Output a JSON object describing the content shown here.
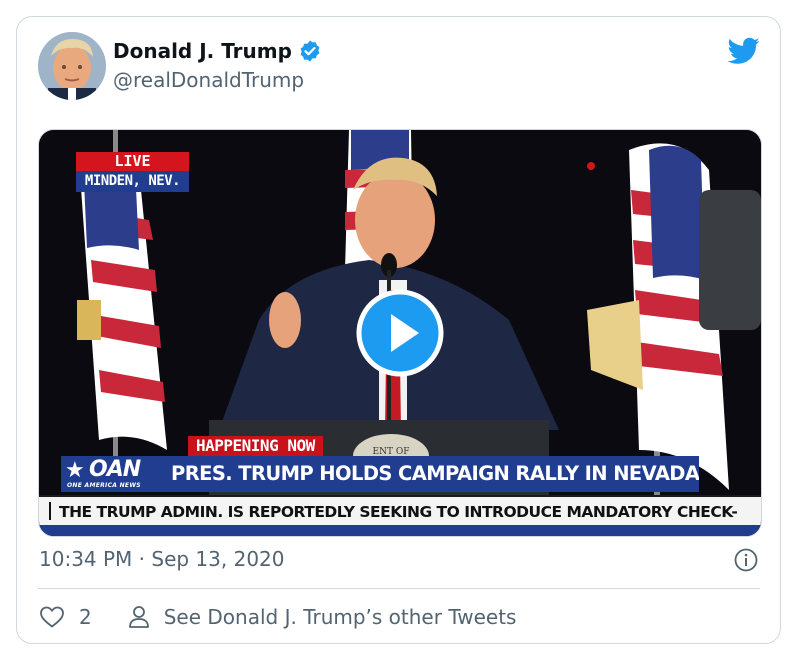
{
  "tweet": {
    "author_name": "Donald J. Trump",
    "handle": "@realDonaldTrump",
    "timestamp": "10:34 PM · Sep 13, 2020",
    "like_count": "2",
    "see_other_tweets": "See Donald J. Trump’s other Tweets"
  },
  "video": {
    "live_label": "LIVE",
    "location_label": "MINDEN, NEV.",
    "happening_label": "HAPPENING NOW",
    "network_logo": "OAN",
    "network_subtitle": "ONE AMERICA NEWS",
    "headline": "PRES. TRUMP HOLDS CAMPAIGN RALLY IN NEVADA",
    "ticker": "THE TRUMP ADMIN. IS REPORTEDLY SEEKING TO INTRODUCE MANDATORY CHECK-",
    "podium_seal_text": "ENT OF"
  },
  "icons": {
    "verified": "verified-badge-icon",
    "bird": "twitter-bird-icon",
    "play": "play-icon",
    "info": "info-icon",
    "heart": "heart-icon",
    "person": "person-icon"
  },
  "colors": {
    "twitter_blue": "#1d9bf0",
    "muted_text": "#536471",
    "oan_blue": "#213d8f",
    "news_red": "#c8111a"
  }
}
